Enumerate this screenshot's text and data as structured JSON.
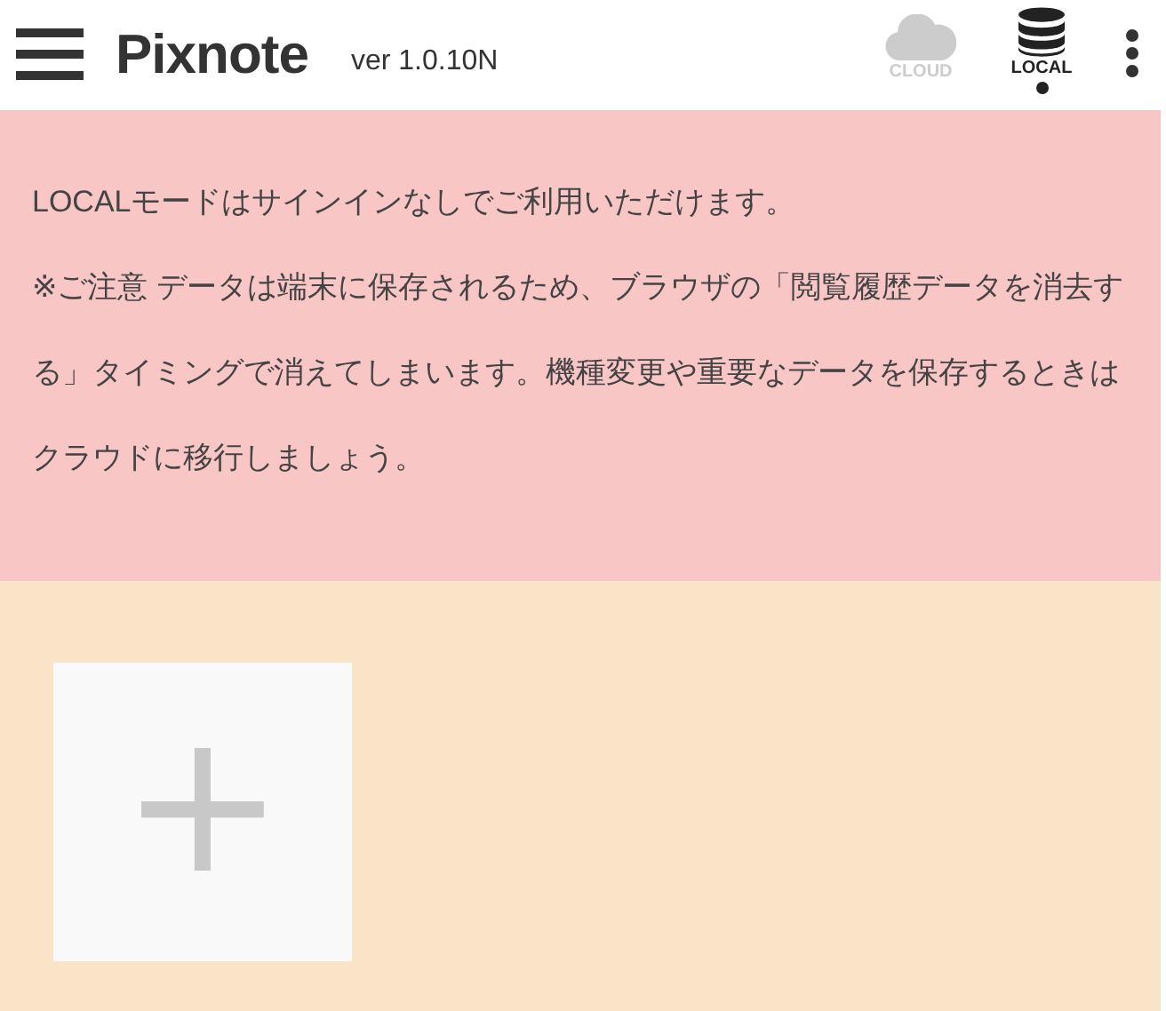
{
  "header": {
    "app_name": "Pixnote",
    "version": "ver 1.0.10N",
    "modes": [
      {
        "label": "CLOUD",
        "kind": "cloud",
        "selected": false
      },
      {
        "label": "LOCAL",
        "kind": "local",
        "selected": true
      }
    ]
  },
  "notice": [
    "LOCALモードはサインインなしでご利用いただけます。",
    "※ご注意 データは端末に保存されるため、ブラウザの「閲覧履歴データを消去する」タイミングで消えてしまいます。機種変更や重要なデータを保存するときはクラウドに移行しましょう。"
  ],
  "add_tile": {
    "label": "+"
  }
}
